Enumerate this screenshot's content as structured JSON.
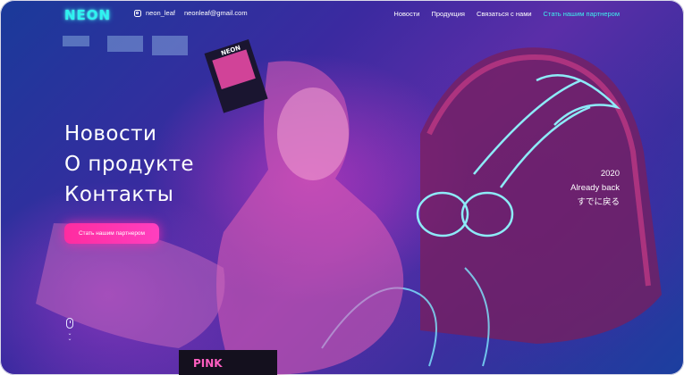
{
  "header": {
    "logo": "NEON",
    "instagram": {
      "icon": "instagram-icon",
      "handle": "neon_leaf"
    },
    "email": "neonleaf@gmail.com",
    "nav": [
      {
        "label": "Новости"
      },
      {
        "label": "Продукция"
      },
      {
        "label": "Связаться с нами"
      },
      {
        "label": "Стать нашим партнером",
        "accent": true
      }
    ]
  },
  "hero": {
    "menu": [
      "Новости",
      "О продукте",
      "Контакты"
    ],
    "cta_label": "Стать нашим партнером"
  },
  "side": {
    "year": "2020",
    "tagline": "Already back",
    "japanese": "すでに戻る"
  },
  "art": {
    "shirt_text": "PINK",
    "book_text": "NEON"
  },
  "scroll": {
    "icon": "mouse-icon",
    "chevron_icon": "chevron-down-icon"
  },
  "colors": {
    "accent": "#3ff0ef",
    "cta": "#ff2ca0",
    "background": "#2a2f9e"
  }
}
